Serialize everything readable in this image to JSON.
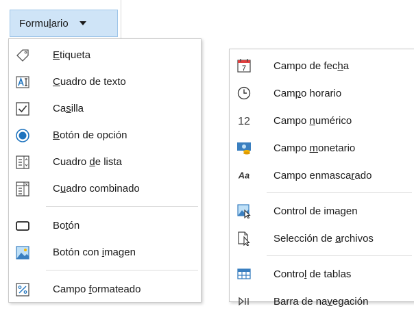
{
  "toolbar": {
    "button_parts": [
      "Formu",
      "l",
      "ario"
    ]
  },
  "left_menu": [
    {
      "icon": "label-tag-icon",
      "pre": "",
      "acc": "E",
      "post": "tiqueta"
    },
    {
      "icon": "text-box-icon",
      "pre": "",
      "acc": "C",
      "post": "uadro de texto"
    },
    {
      "icon": "checkbox-icon",
      "pre": "Ca",
      "acc": "s",
      "post": "illa"
    },
    {
      "icon": "radio-button-icon",
      "pre": "",
      "acc": "B",
      "post": "otón de opción"
    },
    {
      "icon": "list-box-icon",
      "pre": "Cuadro ",
      "acc": "d",
      "post": "e lista"
    },
    {
      "icon": "combo-box-icon",
      "pre": "C",
      "acc": "u",
      "post": "adro combinado"
    },
    {
      "icon": "push-button-icon",
      "pre": "Bo",
      "acc": "t",
      "post": "ón"
    },
    {
      "icon": "image-button-icon",
      "pre": "Botón con ",
      "acc": "i",
      "post": "magen"
    },
    {
      "icon": "formatted-field-icon",
      "pre": "Campo ",
      "acc": "f",
      "post": "ormateado"
    }
  ],
  "right_menu": [
    {
      "icon": "calendar-date-icon",
      "pre": "Campo de fec",
      "acc": "h",
      "post": "a",
      "icon_text": "7"
    },
    {
      "icon": "clock-icon",
      "pre": "Cam",
      "acc": "p",
      "post": "o horario"
    },
    {
      "icon": "numeric-field-icon",
      "pre": "Campo ",
      "acc": "n",
      "post": "umérico",
      "icon_text": "12"
    },
    {
      "icon": "currency-icon",
      "pre": "Campo ",
      "acc": "m",
      "post": "onetario"
    },
    {
      "icon": "pattern-field-icon",
      "pre": "Campo enmasca",
      "acc": "r",
      "post": "ado",
      "icon_text": "Aa"
    },
    {
      "icon": "image-control-icon",
      "pre": "Control de ima",
      "acc": "g",
      "post": "en"
    },
    {
      "icon": "file-selection-icon",
      "pre": "Selección de ",
      "acc": "a",
      "post": "rchivos"
    },
    {
      "icon": "table-control-icon",
      "pre": "Contro",
      "acc": "l",
      "post": " de tablas"
    },
    {
      "icon": "navigation-bar-icon",
      "pre": "Barra de na",
      "acc": "v",
      "post": "egación",
      "icon_text": "▷⏸"
    }
  ],
  "colors": {
    "accent": "#1e73be",
    "button_bg": "#cfe4f7"
  }
}
